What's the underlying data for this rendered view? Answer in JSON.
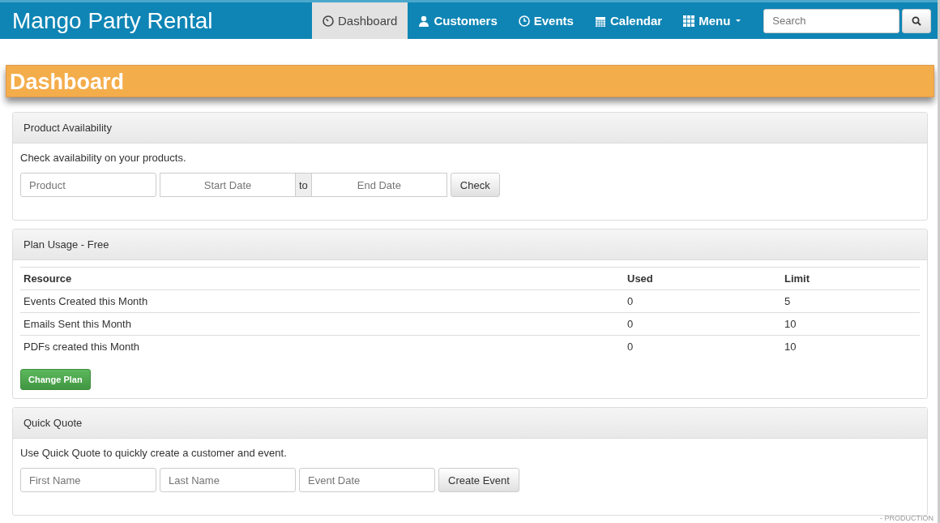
{
  "brand": "Mango Party Rental",
  "nav": [
    {
      "label": "Dashboard",
      "kind": "dashboard",
      "selected": true
    },
    {
      "label": "Customers",
      "kind": "customers",
      "selected": false
    },
    {
      "label": "Events",
      "kind": "events",
      "selected": false
    },
    {
      "label": "Calendar",
      "kind": "calendar",
      "selected": false
    },
    {
      "label": "Menu",
      "kind": "menu",
      "selected": false,
      "dropdown": true
    }
  ],
  "search": {
    "placeholder": "Search"
  },
  "page_title": "Dashboard",
  "availability": {
    "title": "Product Availability",
    "text": "Check availability on your products.",
    "product_placeholder": "Product",
    "start_placeholder": "Start Date",
    "separator": "to",
    "end_placeholder": "End Date",
    "button": "Check"
  },
  "plan": {
    "title": "Plan Usage - Free",
    "columns": [
      "Resource",
      "Used",
      "Limit"
    ],
    "rows": [
      [
        "Events Created this Month",
        "0",
        "5"
      ],
      [
        "Emails Sent this Month",
        "0",
        "10"
      ],
      [
        "PDFs created this Month",
        "0",
        "10"
      ]
    ],
    "button": "Change Plan"
  },
  "quote": {
    "title": "Quick Quote",
    "text": "Use Quick Quote to quickly create a customer and event.",
    "fields": [
      {
        "placeholder": "First Name"
      },
      {
        "placeholder": "Last Name"
      },
      {
        "placeholder": "Event Date"
      }
    ],
    "button": "Create Event"
  },
  "environment": "- PRODUCTION"
}
